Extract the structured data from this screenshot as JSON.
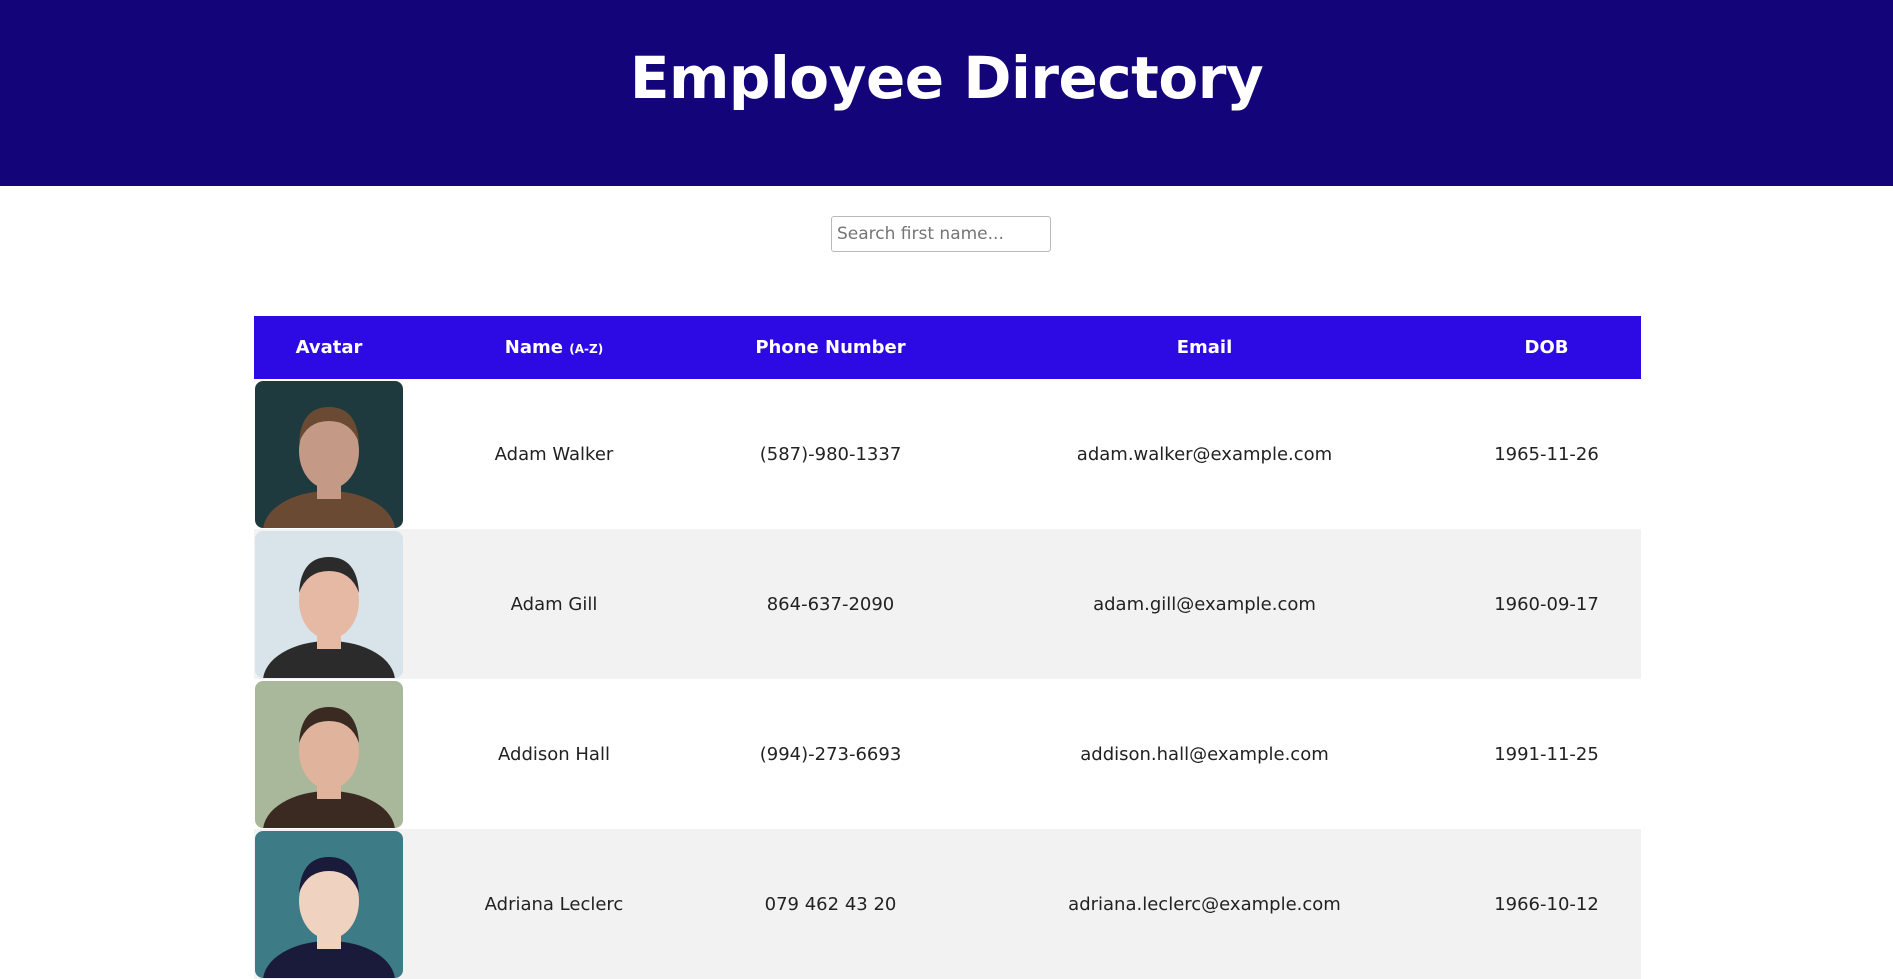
{
  "header": {
    "title": "Employee Directory"
  },
  "search": {
    "placeholder": "Search first name...",
    "value": ""
  },
  "table": {
    "columns": {
      "avatar": "Avatar",
      "name": "Name",
      "name_sort_hint": "(A-Z)",
      "phone": "Phone Number",
      "email": "Email",
      "dob": "DOB"
    },
    "rows": [
      {
        "name": "Adam Walker",
        "phone": "(587)-980-1337",
        "email": "adam.walker@example.com",
        "dob": "1965-11-26",
        "avatar_colors": [
          "#1f3a3f",
          "#c49a86",
          "#6b4a34"
        ]
      },
      {
        "name": "Adam Gill",
        "phone": "864-637-2090",
        "email": "adam.gill@example.com",
        "dob": "1960-09-17",
        "avatar_colors": [
          "#d9e4ea",
          "#e5b9a3",
          "#2b2b2b"
        ]
      },
      {
        "name": "Addison Hall",
        "phone": "(994)-273-6693",
        "email": "addison.hall@example.com",
        "dob": "1991-11-25",
        "avatar_colors": [
          "#a9b89a",
          "#e0b39c",
          "#3a2a22"
        ]
      },
      {
        "name": "Adriana Leclerc",
        "phone": "079 462 43 20",
        "email": "adriana.leclerc@example.com",
        "dob": "1966-10-12",
        "avatar_colors": [
          "#3d7c86",
          "#f0d2c0",
          "#1a1a3a"
        ]
      }
    ]
  },
  "colors": {
    "header_bg": "#13047a",
    "table_header_bg": "#2d0ae3",
    "row_stripe": "#f2f2f2"
  }
}
